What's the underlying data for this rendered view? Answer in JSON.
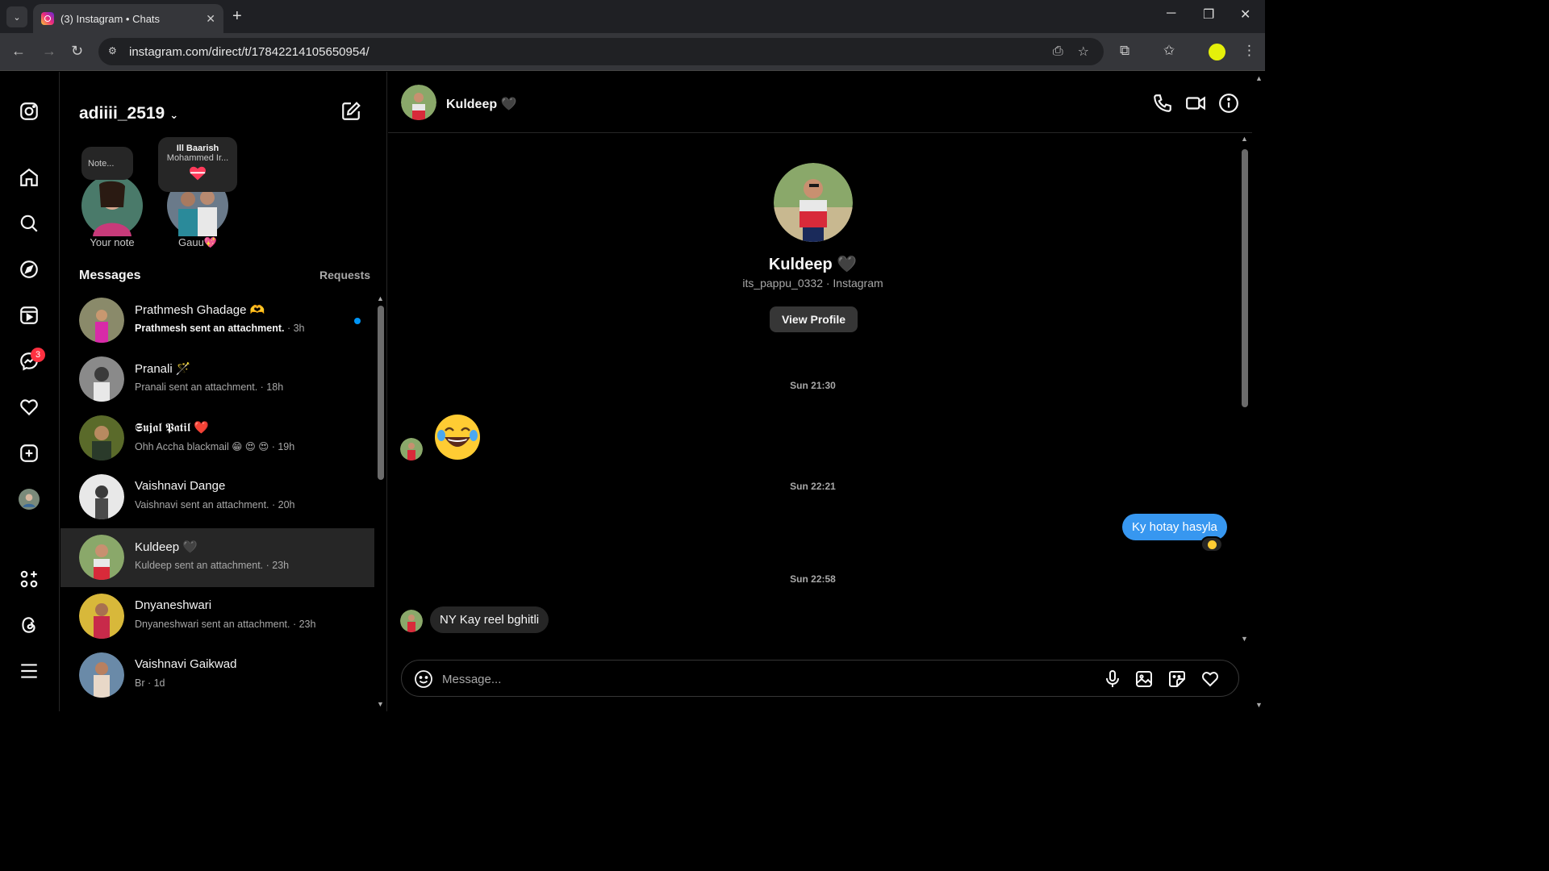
{
  "browser": {
    "tab_title": "(3) Instagram • Chats",
    "url": "instagram.com/direct/t/17842214105650954/",
    "close_tab": "✕",
    "new_tab": "+",
    "tab_menu": "⌄"
  },
  "sidebar": {
    "messages_badge": "3"
  },
  "inbox": {
    "username": "adiiii_2519",
    "notes": [
      {
        "bubble": "Note...",
        "label": "Your note"
      },
      {
        "bubble_title": "Ill Baarish",
        "bubble_sub": "Mohammed Ir...",
        "label": "Gauu💖"
      }
    ],
    "messages_heading": "Messages",
    "requests_label": "Requests",
    "conversations": [
      {
        "name": "Prathmesh Ghadage 🫶",
        "preview": "Prathmesh sent an attachment.",
        "time": " · 3h",
        "unread": true
      },
      {
        "name": "Pranali 🪄",
        "preview": "Pranali sent an attachment.",
        "time": " · 18h",
        "unread": false
      },
      {
        "name": "𝕾𝖚𝖏𝖆𝖑 𝕻𝖆𝖙𝖎𝖑 ❤️",
        "preview": "Ohh Accha blackmail 😁 😍 😍",
        "time": " · 19h",
        "unread": false
      },
      {
        "name": "Vaishnavi Dange",
        "preview": "Vaishnavi sent an attachment.",
        "time": " · 20h",
        "unread": false
      },
      {
        "name": "Kuldeep 🖤",
        "preview": "Kuldeep sent an attachment.",
        "time": " · 23h",
        "unread": false,
        "active": true
      },
      {
        "name": "Dnyaneshwari",
        "preview": "Dnyaneshwari sent an attachment.",
        "time": " · 23h",
        "unread": false
      },
      {
        "name": "Vaishnavi Gaikwad",
        "preview": "Br",
        "time": " · 1d",
        "unread": false
      }
    ]
  },
  "chat": {
    "header_name": "Kuldeep 🖤",
    "profile_name": "Kuldeep 🖤",
    "profile_sub": "its_pappu_0332 · Instagram",
    "view_profile": "View Profile",
    "timestamps": [
      "Sun 21:30",
      "Sun 22:21",
      "Sun 22:58"
    ],
    "messages": [
      {
        "from": "them",
        "type": "emoji",
        "text": "😂"
      },
      {
        "from": "me",
        "type": "text",
        "text": "Ky hotay hasyla",
        "reaction": "😍"
      },
      {
        "from": "them",
        "type": "text",
        "text": "NY Kay reel bghitli"
      }
    ],
    "composer_placeholder": "Message..."
  },
  "colors": {
    "accent_blue": "#3797f0",
    "unread_dot": "#0095f6",
    "badge_red": "#ff3040",
    "bg": "#000000",
    "active_row": "#262626"
  }
}
